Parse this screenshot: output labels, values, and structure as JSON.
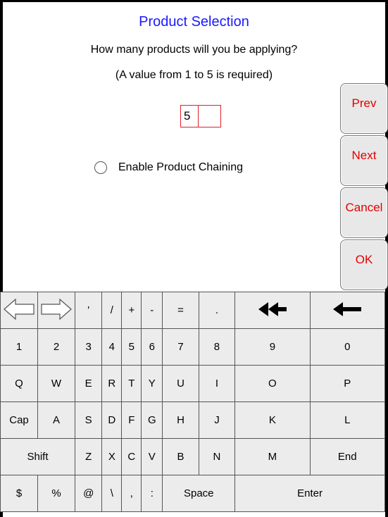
{
  "header": {
    "title": "Product Selection",
    "question": "How many products will you be applying?",
    "hint": "(A value from 1 to 5 is required)"
  },
  "entry": {
    "value": "5"
  },
  "chaining": {
    "label": "Enable Product Chaining",
    "checked": false
  },
  "side_buttons": [
    "Prev",
    "Next",
    "Cancel",
    "OK"
  ],
  "keyboard": {
    "row0": [
      "⇦",
      "⇨",
      "'",
      "/",
      "+",
      "-",
      "=",
      ".",
      "⯇⯇",
      "⟵"
    ],
    "row1": [
      "1",
      "2",
      "3",
      "4",
      "5",
      "6",
      "7",
      "8",
      "9",
      "0"
    ],
    "row2": [
      "Q",
      "W",
      "E",
      "R",
      "T",
      "Y",
      "U",
      "I",
      "O",
      "P"
    ],
    "row3": [
      "Cap",
      "A",
      "S",
      "D",
      "F",
      "G",
      "H",
      "J",
      "K",
      "L"
    ],
    "row4": [
      "Shift",
      "Z",
      "X",
      "C",
      "V",
      "B",
      "N",
      "M",
      "End"
    ],
    "row5": [
      "$",
      "%",
      "@",
      "\\",
      ",",
      ":",
      "Space",
      "Enter"
    ]
  },
  "colors": {
    "title": "#1a1aff",
    "button_text": "#e30000",
    "entry_border": "#e0202a"
  }
}
